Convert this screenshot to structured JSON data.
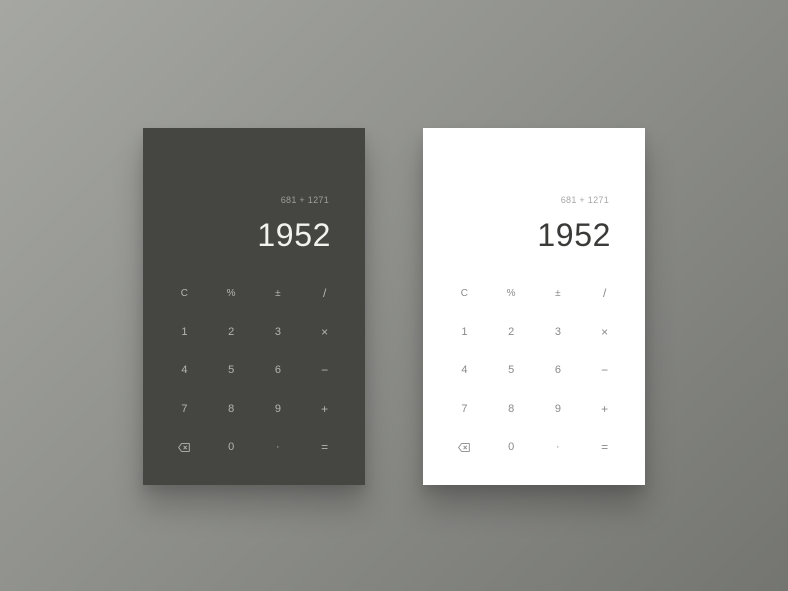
{
  "calculators": [
    {
      "theme": "dark",
      "background": "#454542",
      "expression": "681 + 1271",
      "result": "1952",
      "keys": {
        "clear": "C",
        "percent": "%",
        "plus_minus": "±",
        "divide": "/",
        "seven_row": [
          "7",
          "8",
          "9"
        ],
        "four_row": [
          "4",
          "5",
          "6"
        ],
        "one_row": [
          "1",
          "2",
          "3"
        ],
        "multiply": "×",
        "subtract": "−",
        "add": "+",
        "backspace_icon": "backspace-icon",
        "zero": "0",
        "decimal": "·",
        "equals": "="
      }
    },
    {
      "theme": "light",
      "background": "#ffffff",
      "expression": "681 + 1271",
      "result": "1952",
      "keys": {
        "clear": "C",
        "percent": "%",
        "plus_minus": "±",
        "divide": "/",
        "seven_row": [
          "7",
          "8",
          "9"
        ],
        "four_row": [
          "4",
          "5",
          "6"
        ],
        "one_row": [
          "1",
          "2",
          "3"
        ],
        "multiply": "×",
        "subtract": "−",
        "add": "+",
        "backspace_icon": "backspace-icon",
        "zero": "0",
        "decimal": "·",
        "equals": "="
      }
    }
  ]
}
